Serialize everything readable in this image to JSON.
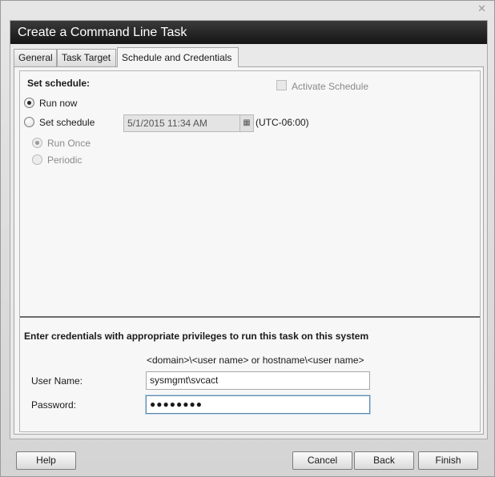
{
  "window": {
    "close_glyph": "✕"
  },
  "dialog": {
    "title": "Create a Command Line Task"
  },
  "tabs": [
    {
      "label": "General"
    },
    {
      "label": "Task Target"
    },
    {
      "label": "Schedule and Credentials"
    }
  ],
  "schedule": {
    "heading": "Set schedule:",
    "activate_label": "Activate Schedule",
    "run_now_label": "Run now",
    "set_schedule_label": "Set schedule",
    "datetime_value": "5/1/2015 11:34 AM",
    "timezone": "(UTC-06:00)",
    "run_once_label": "Run Once",
    "periodic_label": "Periodic",
    "selected": "Run now"
  },
  "credentials": {
    "heading": "Enter credentials with appropriate privileges to run this task on this system",
    "hint": "<domain>\\<user name> or hostname\\<user name>",
    "username_label": "User Name:",
    "username_value": "sysmgmt\\svcact",
    "password_label": "Password:",
    "password_value": "●●●●●●●●"
  },
  "footer": {
    "help_label": "Help",
    "cancel_label": "Cancel",
    "back_label": "Back",
    "finish_label": "Finish"
  },
  "icons": {
    "calendar": "calendar-icon",
    "close": "close-icon"
  }
}
